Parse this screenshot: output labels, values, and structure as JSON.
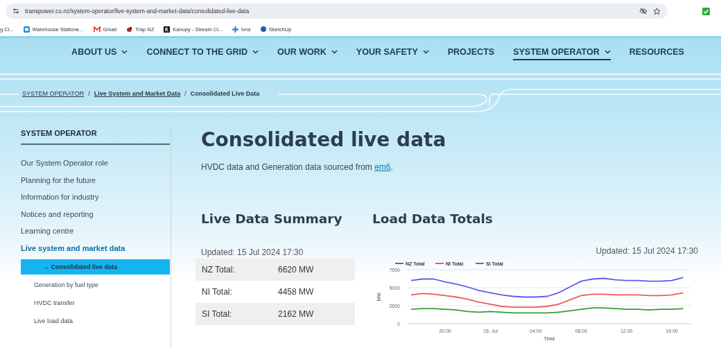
{
  "browser": {
    "url": "transpower.co.nz/system-operator/live-system-and-market-data/consolidated-live-data",
    "bookmarks": [
      {
        "label": "g Cl..."
      },
      {
        "label": "Warehouse Statione..."
      },
      {
        "label": "Gmail"
      },
      {
        "label": "Trap NZ"
      },
      {
        "label": "Kanopy - Stream Cl..."
      },
      {
        "label": "tvnz"
      },
      {
        "label": "SketchUp"
      }
    ]
  },
  "nav": [
    {
      "label": "ABOUT US",
      "has_menu": true,
      "selected": false
    },
    {
      "label": "CONNECT TO THE GRID",
      "has_menu": true,
      "selected": false
    },
    {
      "label": "OUR WORK",
      "has_menu": true,
      "selected": false
    },
    {
      "label": "YOUR SAFETY",
      "has_menu": true,
      "selected": false
    },
    {
      "label": "PROJECTS",
      "has_menu": false,
      "selected": false
    },
    {
      "label": "SYSTEM OPERATOR",
      "has_menu": true,
      "selected": true
    },
    {
      "label": "RESOURCES",
      "has_menu": false,
      "selected": false
    }
  ],
  "breadcrumb": [
    {
      "label": "SYSTEM OPERATOR",
      "kind": "root"
    },
    {
      "label": "/",
      "kind": "separator"
    },
    {
      "label": "Live System and Market Data",
      "kind": "link"
    },
    {
      "label": "/",
      "kind": "separator"
    },
    {
      "label": "Consolidated Live Data",
      "kind": "current"
    }
  ],
  "sidebar": {
    "heading": "SYSTEM OPERATOR",
    "items": [
      {
        "label": "Our System Operator role",
        "selected": false
      },
      {
        "label": "Planning for the future",
        "selected": false
      },
      {
        "label": "Information for industry",
        "selected": false
      },
      {
        "label": "Notices and reporting",
        "selected": false
      },
      {
        "label": "Learning centre",
        "selected": false
      },
      {
        "label": "Live system and market data",
        "selected": true,
        "children": [
          {
            "label": "→ Consolidated live data",
            "selected": true
          },
          {
            "label": "Generation by fuel type",
            "selected": false
          },
          {
            "label": "HVDC transfer",
            "selected": false
          },
          {
            "label": "Live load data",
            "selected": false
          }
        ]
      }
    ]
  },
  "page_title": "Consolidated live data",
  "intro": {
    "text": "HVDC data and Generation data sourced from ",
    "link": "em6",
    "end": "."
  },
  "summary": {
    "heading": "Live Data Summary",
    "updated": "Updated: 15 Jul 2024 17:30",
    "rows": [
      {
        "label": "NZ Total:",
        "value": "6620 MW"
      },
      {
        "label": "NI Total:",
        "value": "4458 MW"
      },
      {
        "label": "SI Total:",
        "value": "2162 MW"
      }
    ]
  },
  "load": {
    "heading": "Load Data Totals",
    "updated": "Updated: 15 Jul 2024 17:30",
    "chart_data": {
      "type": "line",
      "xlabel": "Time",
      "ylabel": "MW",
      "categories": [
        null,
        null,
        null,
        "20:00",
        null,
        null,
        null,
        "15. Jul",
        null,
        null,
        null,
        "04:00",
        null,
        null,
        null,
        "08:00",
        null,
        null,
        null,
        "12:00",
        null,
        null,
        null,
        "16:00",
        null
      ],
      "ylim": [
        0,
        7500
      ],
      "legend": "top",
      "yticks": [
        0,
        2500,
        5000,
        7500
      ],
      "series": [
        {
          "name": "NZ Total",
          "color": "#5b5bf0",
          "values": [
            6000,
            6200,
            6200,
            5800,
            5500,
            5100,
            4600,
            4300,
            4000,
            3800,
            3700,
            3700,
            3800,
            4300,
            5100,
            5900,
            6200,
            6300,
            6100,
            6000,
            6000,
            5900,
            5900,
            6000,
            6400
          ]
        },
        {
          "name": "NI Total",
          "color": "#f05a5a",
          "values": [
            4000,
            4200,
            4100,
            3900,
            3700,
            3400,
            3000,
            2700,
            2400,
            2300,
            2300,
            2300,
            2400,
            2700,
            3300,
            3900,
            4100,
            4100,
            4000,
            4000,
            4000,
            3900,
            3900,
            4000,
            4300
          ]
        },
        {
          "name": "SI Total",
          "color": "#3a9a3a",
          "values": [
            2000,
            2100,
            2100,
            2000,
            1900,
            1700,
            1600,
            1700,
            1600,
            1500,
            1500,
            1500,
            1500,
            1600,
            1800,
            2000,
            2200,
            2200,
            2100,
            2000,
            2000,
            1900,
            2000,
            2000,
            2100
          ]
        }
      ]
    }
  }
}
